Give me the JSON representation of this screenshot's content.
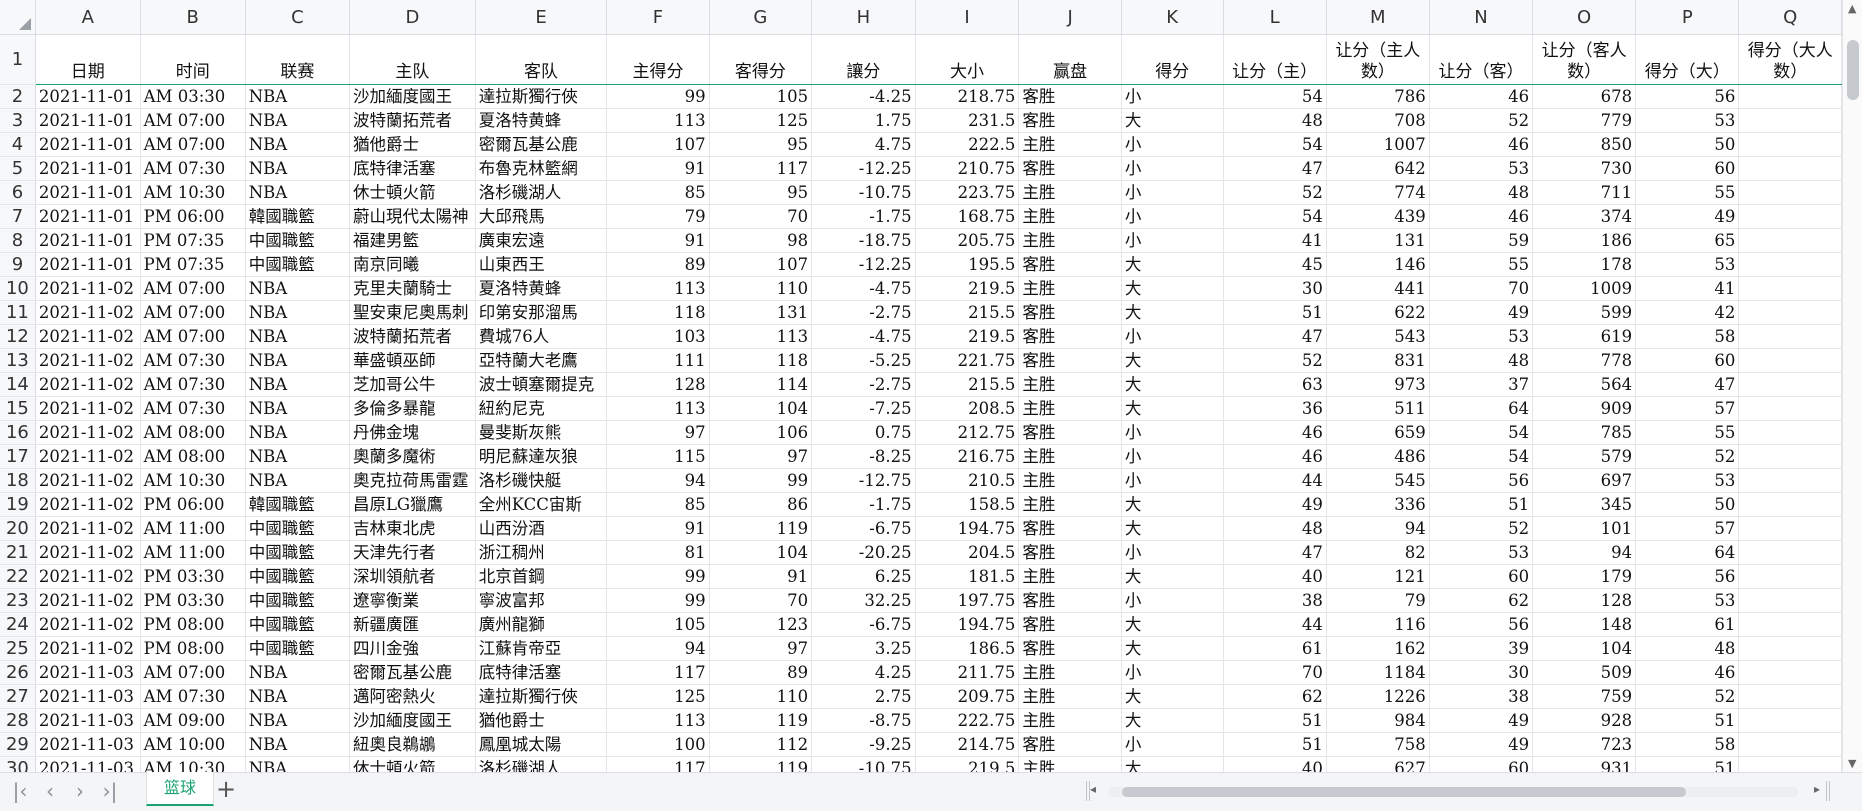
{
  "columns": [
    "A",
    "B",
    "C",
    "D",
    "E",
    "F",
    "G",
    "H",
    "I",
    "J",
    "K",
    "L",
    "M",
    "N",
    "O",
    "P",
    "Q"
  ],
  "header_row": {
    "num": "1",
    "cells": [
      "日期",
      "时间",
      "联赛",
      "主队",
      "客队",
      "主得分",
      "客得分",
      "讓分",
      "大小",
      "赢盘",
      "得分",
      "让分（主）",
      "让分（主人数）",
      "让分（客）",
      "让分（客人数）",
      "得分（大）",
      "得分（大人数）"
    ]
  },
  "rows": [
    {
      "num": "2",
      "cells": [
        "2021-11-01",
        "AM 03:30",
        "NBA",
        "沙加緬度國王",
        "達拉斯獨行俠",
        "99",
        "105",
        "-4.25",
        "218.75",
        "客胜",
        "小",
        "54",
        "786",
        "46",
        "678",
        "56",
        ""
      ]
    },
    {
      "num": "3",
      "cells": [
        "2021-11-01",
        "AM 07:00",
        "NBA",
        "波特蘭拓荒者",
        "夏洛特黄蜂",
        "113",
        "125",
        "1.75",
        "231.5",
        "客胜",
        "大",
        "48",
        "708",
        "52",
        "779",
        "53",
        ""
      ]
    },
    {
      "num": "4",
      "cells": [
        "2021-11-01",
        "AM 07:00",
        "NBA",
        "猶他爵士",
        "密爾瓦基公鹿",
        "107",
        "95",
        "4.75",
        "222.5",
        "主胜",
        "小",
        "54",
        "1007",
        "46",
        "850",
        "50",
        ""
      ]
    },
    {
      "num": "5",
      "cells": [
        "2021-11-01",
        "AM 07:30",
        "NBA",
        "底特律活塞",
        "布魯克林籃網",
        "91",
        "117",
        "-12.25",
        "210.75",
        "客胜",
        "小",
        "47",
        "642",
        "53",
        "730",
        "60",
        ""
      ]
    },
    {
      "num": "6",
      "cells": [
        "2021-11-01",
        "AM 10:30",
        "NBA",
        "休士頓火箭",
        "洛杉磯湖人",
        "85",
        "95",
        "-10.75",
        "223.75",
        "主胜",
        "小",
        "52",
        "774",
        "48",
        "711",
        "55",
        ""
      ]
    },
    {
      "num": "7",
      "cells": [
        "2021-11-01",
        "PM 06:00",
        "韓國職籃",
        "蔚山現代太陽神",
        "大邱飛馬",
        "79",
        "70",
        "-1.75",
        "168.75",
        "主胜",
        "小",
        "54",
        "439",
        "46",
        "374",
        "49",
        ""
      ]
    },
    {
      "num": "8",
      "cells": [
        "2021-11-01",
        "PM 07:35",
        "中國職籃",
        "福建男籃",
        "廣東宏遠",
        "91",
        "98",
        "-18.75",
        "205.75",
        "主胜",
        "小",
        "41",
        "131",
        "59",
        "186",
        "65",
        ""
      ]
    },
    {
      "num": "9",
      "cells": [
        "2021-11-01",
        "PM 07:35",
        "中國職籃",
        "南京同曦",
        "山東西王",
        "89",
        "107",
        "-12.25",
        "195.5",
        "客胜",
        "大",
        "45",
        "146",
        "55",
        "178",
        "53",
        ""
      ]
    },
    {
      "num": "10",
      "cells": [
        "2021-11-02",
        "AM 07:00",
        "NBA",
        "克里夫蘭騎士",
        "夏洛特黄蜂",
        "113",
        "110",
        "-4.75",
        "219.5",
        "主胜",
        "大",
        "30",
        "441",
        "70",
        "1009",
        "41",
        ""
      ]
    },
    {
      "num": "11",
      "cells": [
        "2021-11-02",
        "AM 07:00",
        "NBA",
        "聖安東尼奧馬刺",
        "印第安那溜馬",
        "118",
        "131",
        "-2.75",
        "215.5",
        "客胜",
        "大",
        "51",
        "622",
        "49",
        "599",
        "42",
        ""
      ]
    },
    {
      "num": "12",
      "cells": [
        "2021-11-02",
        "AM 07:00",
        "NBA",
        "波特蘭拓荒者",
        "費城76人",
        "103",
        "113",
        "-4.75",
        "219.5",
        "客胜",
        "小",
        "47",
        "543",
        "53",
        "619",
        "58",
        ""
      ]
    },
    {
      "num": "13",
      "cells": [
        "2021-11-02",
        "AM 07:30",
        "NBA",
        "華盛頓巫師",
        "亞特蘭大老鷹",
        "111",
        "118",
        "-5.25",
        "221.75",
        "客胜",
        "大",
        "52",
        "831",
        "48",
        "778",
        "60",
        ""
      ]
    },
    {
      "num": "14",
      "cells": [
        "2021-11-02",
        "AM 07:30",
        "NBA",
        "芝加哥公牛",
        "波士頓塞爾提克",
        "128",
        "114",
        "-2.75",
        "215.5",
        "主胜",
        "大",
        "63",
        "973",
        "37",
        "564",
        "47",
        ""
      ]
    },
    {
      "num": "15",
      "cells": [
        "2021-11-02",
        "AM 07:30",
        "NBA",
        "多倫多暴龍",
        "紐約尼克",
        "113",
        "104",
        "-7.25",
        "208.5",
        "主胜",
        "大",
        "36",
        "511",
        "64",
        "909",
        "57",
        ""
      ]
    },
    {
      "num": "16",
      "cells": [
        "2021-11-02",
        "AM 08:00",
        "NBA",
        "丹佛金塊",
        "曼斐斯灰熊",
        "97",
        "106",
        "0.75",
        "212.75",
        "客胜",
        "小",
        "46",
        "659",
        "54",
        "785",
        "55",
        ""
      ]
    },
    {
      "num": "17",
      "cells": [
        "2021-11-02",
        "AM 08:00",
        "NBA",
        "奧蘭多魔術",
        "明尼蘇達灰狼",
        "115",
        "97",
        "-8.25",
        "216.75",
        "主胜",
        "小",
        "46",
        "486",
        "54",
        "579",
        "52",
        ""
      ]
    },
    {
      "num": "18",
      "cells": [
        "2021-11-02",
        "AM 10:30",
        "NBA",
        "奧克拉荷馬雷霆",
        "洛杉磯快艇",
        "94",
        "99",
        "-12.75",
        "210.5",
        "主胜",
        "小",
        "44",
        "545",
        "56",
        "697",
        "53",
        ""
      ]
    },
    {
      "num": "19",
      "cells": [
        "2021-11-02",
        "PM 06:00",
        "韓國職籃",
        "昌原LG獵鷹",
        "全州KCC宙斯",
        "85",
        "86",
        "-1.75",
        "158.5",
        "主胜",
        "大",
        "49",
        "336",
        "51",
        "345",
        "50",
        ""
      ]
    },
    {
      "num": "20",
      "cells": [
        "2021-11-02",
        "AM 11:00",
        "中國職籃",
        "吉林東北虎",
        "山西汾酒",
        "91",
        "119",
        "-6.75",
        "194.75",
        "客胜",
        "大",
        "48",
        "94",
        "52",
        "101",
        "57",
        ""
      ]
    },
    {
      "num": "21",
      "cells": [
        "2021-11-02",
        "AM 11:00",
        "中國職籃",
        "天津先行者",
        "浙江稠州",
        "81",
        "104",
        "-20.25",
        "204.5",
        "客胜",
        "小",
        "47",
        "82",
        "53",
        "94",
        "64",
        ""
      ]
    },
    {
      "num": "22",
      "cells": [
        "2021-11-02",
        "PM 03:30",
        "中國職籃",
        "深圳領航者",
        "北京首鋼",
        "99",
        "91",
        "6.25",
        "181.5",
        "主胜",
        "大",
        "40",
        "121",
        "60",
        "179",
        "56",
        ""
      ]
    },
    {
      "num": "23",
      "cells": [
        "2021-11-02",
        "PM 03:30",
        "中國職籃",
        "遼寧衡業",
        "寧波富邦",
        "99",
        "70",
        "32.25",
        "197.75",
        "客胜",
        "小",
        "38",
        "79",
        "62",
        "128",
        "53",
        ""
      ]
    },
    {
      "num": "24",
      "cells": [
        "2021-11-02",
        "PM 08:00",
        "中國職籃",
        "新疆廣匯",
        "廣州龍獅",
        "105",
        "123",
        "-6.75",
        "194.75",
        "客胜",
        "大",
        "44",
        "116",
        "56",
        "148",
        "61",
        ""
      ]
    },
    {
      "num": "25",
      "cells": [
        "2021-11-02",
        "PM 08:00",
        "中國職籃",
        "四川金強",
        "江蘇肯帝亞",
        "94",
        "97",
        "3.25",
        "186.5",
        "客胜",
        "大",
        "61",
        "162",
        "39",
        "104",
        "48",
        ""
      ]
    },
    {
      "num": "26",
      "cells": [
        "2021-11-03",
        "AM 07:00",
        "NBA",
        "密爾瓦基公鹿",
        "底特律活塞",
        "117",
        "89",
        "4.25",
        "211.75",
        "主胜",
        "小",
        "70",
        "1184",
        "30",
        "509",
        "46",
        ""
      ]
    },
    {
      "num": "27",
      "cells": [
        "2021-11-03",
        "AM 07:30",
        "NBA",
        "邁阿密熱火",
        "達拉斯獨行俠",
        "125",
        "110",
        "2.75",
        "209.75",
        "主胜",
        "大",
        "62",
        "1226",
        "38",
        "759",
        "52",
        ""
      ]
    },
    {
      "num": "28",
      "cells": [
        "2021-11-03",
        "AM 09:00",
        "NBA",
        "沙加緬度國王",
        "猶他爵士",
        "113",
        "119",
        "-8.75",
        "222.75",
        "主胜",
        "大",
        "51",
        "984",
        "49",
        "928",
        "51",
        ""
      ]
    },
    {
      "num": "29",
      "cells": [
        "2021-11-03",
        "AM 10:00",
        "NBA",
        "紐奧良鵜鶘",
        "鳳凰城太陽",
        "100",
        "112",
        "-9.25",
        "214.75",
        "客胜",
        "小",
        "51",
        "758",
        "49",
        "723",
        "58",
        ""
      ]
    },
    {
      "num": "30",
      "cells": [
        "2021-11-03",
        "AM 10:30",
        "NBA",
        "休士頓火箭",
        "洛杉磯湖人",
        "117",
        "119",
        "-10.75",
        "219.5",
        "主胜",
        "大",
        "40",
        "627",
        "60",
        "931",
        "51",
        ""
      ]
    }
  ],
  "sheet_tab": "篮球",
  "colors": {
    "accent": "#1aa36f",
    "header_bg": "#f7f8fa",
    "grid": "#e3e5e8"
  }
}
